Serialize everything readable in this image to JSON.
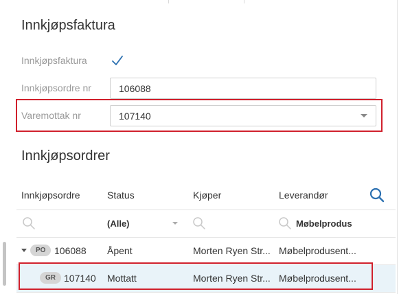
{
  "invoice_section": {
    "title": "Innkjøpsfaktura",
    "invoice_label": "Innkjøpsfaktura",
    "invoice_checked": true,
    "po_label": "Innkjøpsordre nr",
    "po_value": "106088",
    "gr_label": "Varemottak nr",
    "gr_value": "107140"
  },
  "orders_section": {
    "title": "Innkjøpsordrer",
    "columns": [
      "Innkjøpsordre",
      "Status",
      "Kjøper",
      "Leverandør"
    ],
    "filters": {
      "status": "(Alle)",
      "supplier": "Møbelprodus"
    },
    "rows": [
      {
        "badge": "PO",
        "number": "106088",
        "status": "Åpent",
        "buyer": "Morten Ryen Str...",
        "supplier": "Møbelprodusent..."
      },
      {
        "badge": "GR",
        "number": "107140",
        "status": "Mottatt",
        "buyer": "Morten Ryen Str...",
        "supplier": "Møbelprodusent..."
      }
    ]
  },
  "colors": {
    "accent": "#2a6fb0",
    "highlight": "#d0202c",
    "selected_row": "#e9f3f9"
  },
  "icons": {
    "checkbox": "checkmark-icon",
    "table_search": "search-icon",
    "filter": "search-icon"
  }
}
